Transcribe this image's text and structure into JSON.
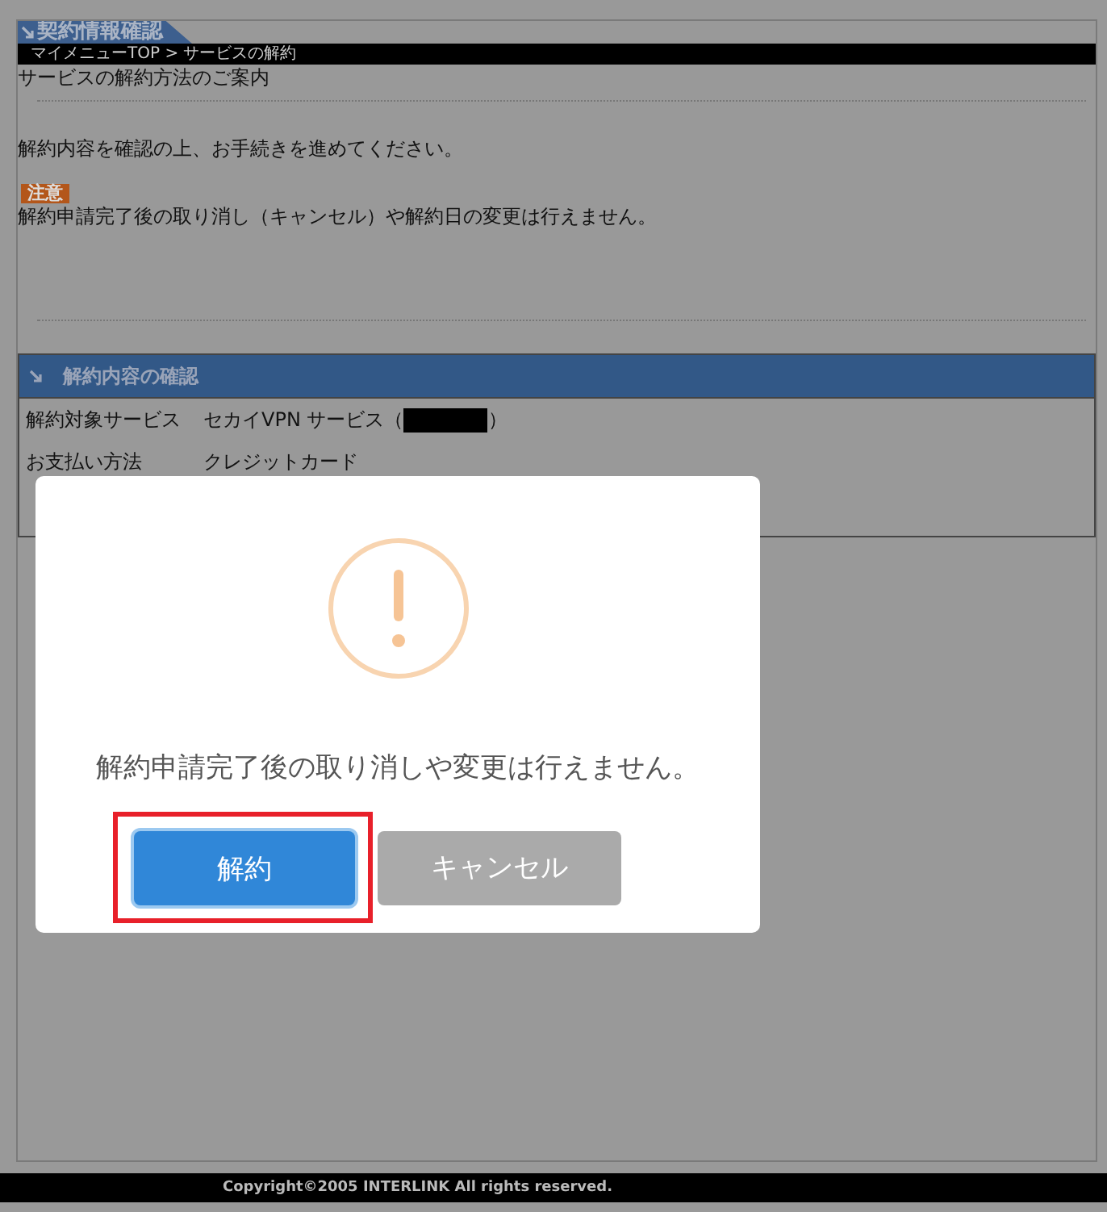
{
  "page_title": "契約情報確認",
  "breadcrumb": "マイメニューTOP > サービスの解約",
  "heading": "サービスの解約方法のご案内",
  "intro": "解約内容を確認の上、お手続きを進めてください。",
  "notice": {
    "badge": "注意",
    "text": "解約申請完了後の取り消し（キャンセル）や解約日の変更は行えません。"
  },
  "section": {
    "title": "解約内容の確認",
    "rows": [
      {
        "label": "解約対象サービス",
        "value": "セカイVPN サービス（",
        "redacted": true,
        "value_end": "）"
      },
      {
        "label": "お支払い方法",
        "value": "クレジットカード"
      }
    ]
  },
  "dialog": {
    "message": "解約申請完了後の取り消しや変更は行えません。",
    "buttons": [
      {
        "label": "解約",
        "kind": "confirm",
        "focused": true
      },
      {
        "label": "キャンセル",
        "kind": "cancel",
        "focused": false
      }
    ]
  },
  "footer": "Copyright©2005 INTERLINK All rights reserved."
}
